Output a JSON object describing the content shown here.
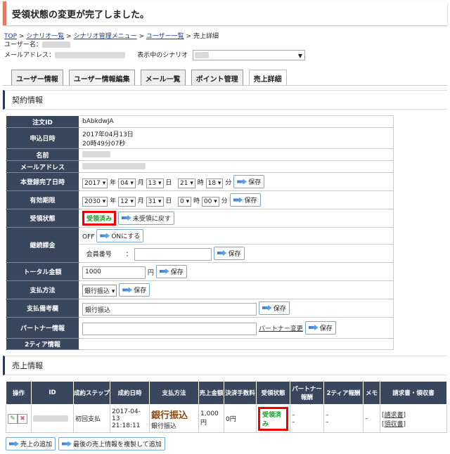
{
  "banner": {
    "message": "受領状態の変更が完了しました。"
  },
  "breadcrumb": [
    "TOP",
    "シナリオ一覧",
    "シナリオ管理メニュー",
    "ユーザー一覧",
    "売上詳細"
  ],
  "meta": {
    "user_label": "ユーザー名：",
    "email_label": "メールアドレス：",
    "scenario_label": "表示中のシナリオ"
  },
  "tabs": [
    "ユーザー情報",
    "ユーザー情報編集",
    "メール一覧",
    "ポイント管理",
    "売上詳細"
  ],
  "contract": {
    "heading": "契約情報",
    "labels": {
      "order_id": "注文ID",
      "applied": "申込日時",
      "name": "名前",
      "email": "メールアドレス",
      "registered": "本登録完了日時",
      "expiry": "有効期限",
      "receipt": "受領状態",
      "billing": "継続課金",
      "total": "トータル金額",
      "payment": "支払方法",
      "payment_note": "支払備考欄",
      "partner": "パートナー情報",
      "tier2": "2ティア情報"
    },
    "order_id": "bAbkdwJA",
    "applied_date": "2017年04月13日",
    "applied_time": "20時49分07秒",
    "registered": {
      "year": "2017",
      "month": "04",
      "day": "13",
      "hour": "21",
      "minute": "18"
    },
    "expiry": {
      "year": "2030",
      "month": "12",
      "day": "31",
      "hour": "0",
      "minute": "00"
    },
    "units": {
      "y": "年",
      "m": "月",
      "d": "日",
      "h": "時",
      "mi": "分"
    },
    "save": "保存",
    "receipt_status": "受領済み",
    "revert_button": "未受領に戻す",
    "billing_status": "OFF",
    "billing_on_button": "ONにする",
    "member_no_label": "会員番号",
    "member_no_colon": "：",
    "total_value": "1000",
    "yen": "円",
    "payment_method": "銀行振込",
    "payment_note_value": "銀行振込",
    "partner_change": "パートナー変更"
  },
  "sales": {
    "heading": "売上情報",
    "columns": [
      "操作",
      "ID",
      "成約ステップ",
      "成約日時",
      "支払方法",
      "売上金額",
      "決済手数料",
      "受領状態",
      "パートナー報酬",
      "2ティア報酬",
      "メモ",
      "請求書・領収書"
    ],
    "row": {
      "step": "初回支払",
      "date": "2017-04-13",
      "time": "21:18:11",
      "method_big": "銀行振込",
      "method_small": "銀行振込",
      "amount": "1,000円",
      "fee": "0円",
      "status": "受領済み",
      "dash": "–",
      "invoice": "[請求書]",
      "receipt": "[領収書]"
    }
  },
  "bottom": {
    "add": "売上の追加",
    "duplicate": "最後の売上情報を複製して追加"
  }
}
